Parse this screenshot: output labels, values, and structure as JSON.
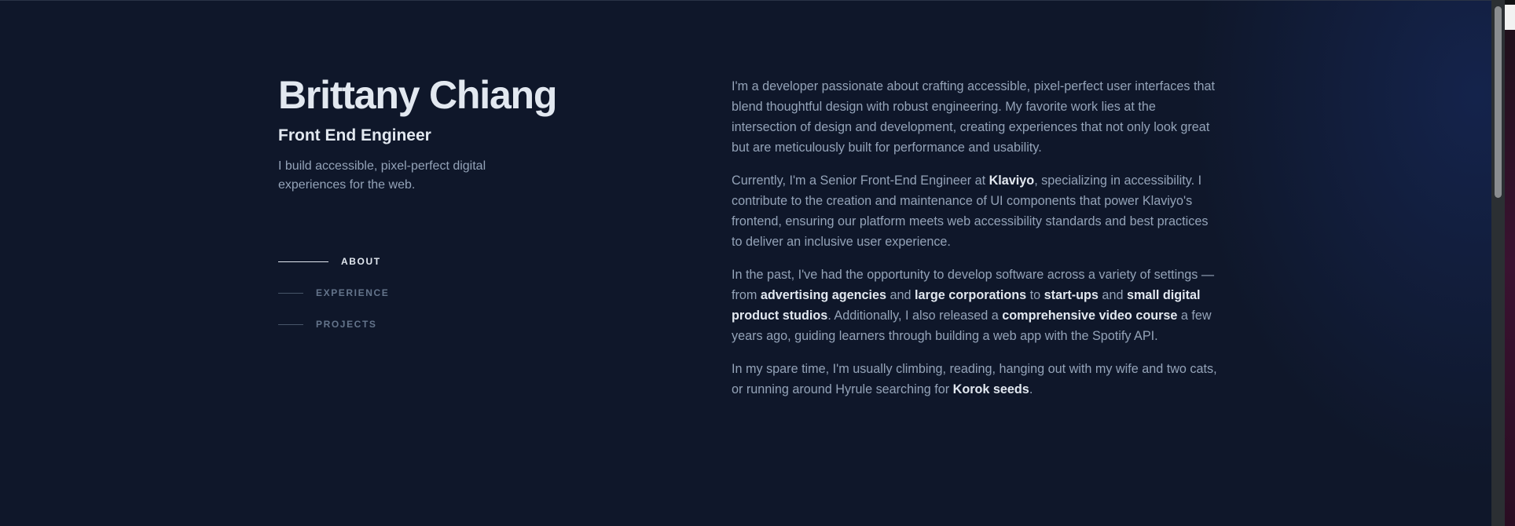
{
  "header": {
    "name": "Brittany Chiang",
    "role": "Front End Engineer",
    "tagline": "I build accessible, pixel-perfect digital experiences for the web."
  },
  "nav": {
    "items": [
      {
        "label": "ABOUT",
        "active": true
      },
      {
        "label": "EXPERIENCE",
        "active": false
      },
      {
        "label": "PROJECTS",
        "active": false
      }
    ]
  },
  "about": {
    "p1": "I'm a developer passionate about crafting accessible, pixel-perfect user interfaces that blend thoughtful design with robust engineering. My favorite work lies at the intersection of design and development, creating experiences that not only look great but are meticulously built for performance and usability.",
    "p2": {
      "t1": "Currently, I'm a Senior Front-End Engineer at ",
      "l1": "Klaviyo",
      "t2": ", specializing in accessibility. I contribute to the creation and maintenance of UI components that power Klaviyo's frontend, ensuring our platform meets web accessibility standards and best practices to deliver an inclusive user experience."
    },
    "p3": {
      "t1": "In the past, I've had the opportunity to develop software across a variety of settings — from ",
      "l1": "advertising agencies",
      "t2": " and ",
      "l2": "large corporations",
      "t3": " to ",
      "l3": "start-ups",
      "t4": " and ",
      "l4": "small digital product studios",
      "t5": ". Additionally, I also released a ",
      "l5": "comprehensive video course",
      "t6": " a few years ago, guiding learners through building a web app with the Spotify API."
    },
    "p4": {
      "t1": "In my spare time, I'm usually climbing, reading, hanging out with my wife and two cats, or running around Hyrule searching for ",
      "l1": "Korok seeds",
      "t2": "."
    }
  },
  "colors": {
    "background": "#0f172a",
    "heading": "#e2e8f0",
    "body_text": "#94a3b8",
    "nav_inactive": "#64748b"
  }
}
